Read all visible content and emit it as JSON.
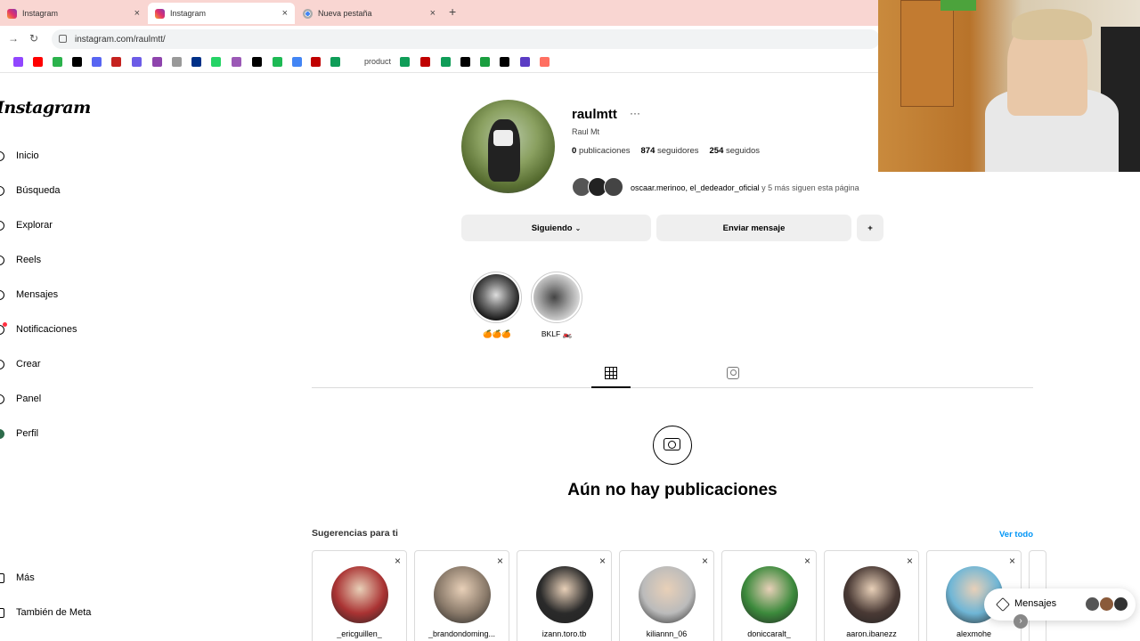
{
  "browser": {
    "tabs": [
      {
        "title": "Instagram",
        "icon": "instagram-icon",
        "active": false
      },
      {
        "title": "Instagram",
        "icon": "instagram-icon",
        "active": true
      },
      {
        "title": "Nueva pestaña",
        "icon": "chrome-icon",
        "active": false
      }
    ],
    "close_glyph": "×",
    "new_tab_glyph": "+",
    "back_glyph": "→",
    "reload_glyph": "↻",
    "url": "instagram.com/raulmtt/",
    "bookmarks_text": "product",
    "bookmark_colors": [
      "#9146ff",
      "#ff0000",
      "#2bb24c",
      "#000000",
      "#5865f2",
      "#c5221f",
      "#6c5ce7",
      "#8e44ad",
      "#999999",
      "#003087",
      "#25d366",
      "#9b59b6",
      "#000000",
      "#1db954",
      "#4285f4",
      "#c00000",
      "#0f9d58",
      "#0f9d58",
      "#c00000",
      "#0f9d58",
      "#000000",
      "#1a9e3f",
      "#000000",
      "#5b3cc4",
      "#ff6f61"
    ]
  },
  "sidebar": {
    "logo": "Instagram",
    "items": [
      {
        "label": "Inicio",
        "icon": "home-icon"
      },
      {
        "label": "Búsqueda",
        "icon": "search-icon"
      },
      {
        "label": "Explorar",
        "icon": "compass-icon"
      },
      {
        "label": "Reels",
        "icon": "reels-icon"
      },
      {
        "label": "Mensajes",
        "icon": "messenger-icon"
      },
      {
        "label": "Notificaciones",
        "icon": "heart-icon"
      },
      {
        "label": "Crear",
        "icon": "plus-icon"
      },
      {
        "label": "Panel",
        "icon": "dashboard-icon"
      },
      {
        "label": "Perfil",
        "icon": "profile-avatar-icon"
      }
    ],
    "bottom": [
      {
        "label": "Más",
        "icon": "menu-icon"
      },
      {
        "label": "También de Meta",
        "icon": "meta-icon"
      }
    ]
  },
  "profile": {
    "username": "raulmtt",
    "more": "···",
    "full_name": "Raul Mt",
    "posts_count": "0",
    "posts_label": "publicaciones",
    "followers_count": "874",
    "followers_label": "seguidores",
    "following_count": "254",
    "following_label": "seguidos",
    "mutual_names": "oscaar.merinoo, el_dedeador_oficial",
    "mutual_suffix": " y 5 más siguen esta página",
    "buttons": {
      "following": "Siguiendo",
      "following_chevron": "⌄",
      "message": "Enviar mensaje",
      "add_person": "+"
    },
    "highlights": [
      {
        "label": "🍊🍊🍊"
      },
      {
        "label": "BKLF 🏍️"
      }
    ]
  },
  "content": {
    "empty_title": "Aún no hay publicaciones",
    "suggestions_title": "Sugerencias para ti",
    "see_all": "Ver todo",
    "suggestions": [
      {
        "username": "_ericguillen_",
        "color": "#a33"
      },
      {
        "username": "_brandondoming...",
        "color": "#8a7a6a"
      },
      {
        "username": "izann.toro.tb",
        "color": "#2a2a2a"
      },
      {
        "username": "kiliannn_06",
        "color": "#bbbbbb"
      },
      {
        "username": "doniccaralt_",
        "color": "#3c8a3c"
      },
      {
        "username": "aaron.ibanezz",
        "color": "#4a3a35"
      },
      {
        "username": "alexmohe",
        "color": "#6fb6d6"
      }
    ]
  },
  "messages_pill": {
    "label": "Mensajes"
  }
}
